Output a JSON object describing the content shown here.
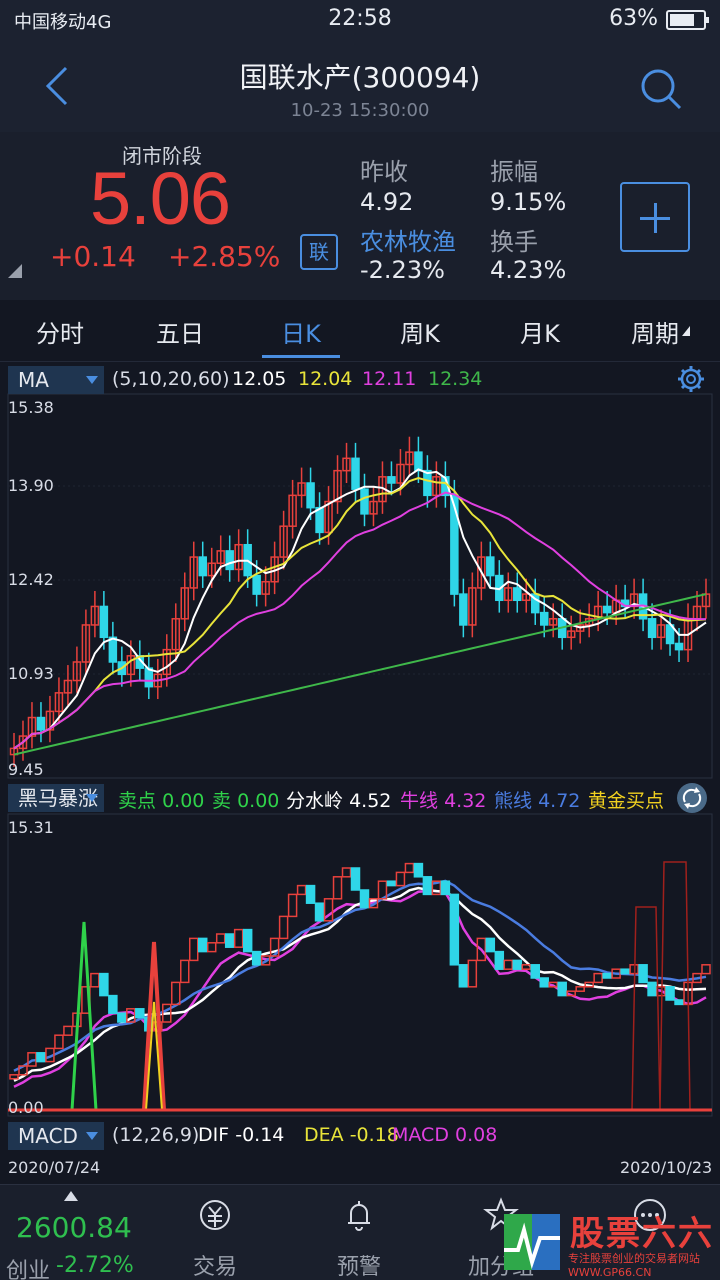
{
  "status": {
    "carrier": "中国移动4G",
    "time": "22:58",
    "battery": "63%"
  },
  "nav": {
    "title": "国联水产(300094)",
    "subtitle": "10-23 15:30:00"
  },
  "quote": {
    "phase": "闭市阶段",
    "price": "5.06",
    "change": "+0.14",
    "change_pct": "+2.85%",
    "badge": "联",
    "prev_close_label": "昨收",
    "prev_close": "4.92",
    "amplitude_label": "振幅",
    "amplitude": "9.15%",
    "sector": "农林牧渔",
    "sector_change": "-2.23%",
    "turnover_label": "换手",
    "turnover": "4.23%"
  },
  "tabs": [
    "分时",
    "五日",
    "日K",
    "周K",
    "月K",
    "周期"
  ],
  "active_tab": "日K",
  "ma": {
    "selector": "MA",
    "params": "(5,10,20,60)",
    "values": [
      {
        "v": "12.05",
        "color": "#ffffff"
      },
      {
        "v": "12.04",
        "color": "#e8e43a"
      },
      {
        "v": "12.11",
        "color": "#e040e0"
      },
      {
        "v": "12.34",
        "color": "#3fb84a"
      }
    ],
    "ylabels": [
      "15.38",
      "13.90",
      "12.42",
      "10.93",
      "9.45"
    ]
  },
  "indicator": {
    "selector": "黑马暴涨",
    "items": [
      {
        "label": "卖点",
        "value": "0.00",
        "color": "#2fd24a"
      },
      {
        "label": "卖",
        "value": "0.00",
        "color": "#2fd24a"
      },
      {
        "label": "分水岭",
        "value": "4.52",
        "color": "#ffffff"
      },
      {
        "label": "牛线",
        "value": "4.32",
        "color": "#e040e0"
      },
      {
        "label": "熊线",
        "value": "4.72",
        "color": "#4a7ce0"
      },
      {
        "label": "黄金买点",
        "value": "",
        "color": "#f0d020"
      }
    ],
    "ylabels": [
      "15.31",
      "0.00"
    ]
  },
  "macd": {
    "selector": "MACD",
    "params": "(12,26,9)",
    "items": [
      {
        "label": "DIF",
        "value": "-0.14",
        "color": "#ffffff"
      },
      {
        "label": "DEA",
        "value": "-0.18",
        "color": "#e8e43a"
      },
      {
        "label": "MACD",
        "value": "0.08",
        "color": "#e040e0"
      }
    ]
  },
  "dates": {
    "start": "2020/07/24",
    "end": "2020/10/23"
  },
  "bottom": {
    "index_value": "2600.84",
    "index_name": "创业",
    "index_change": "-2.72%",
    "nav": [
      "交易",
      "预警",
      "加分组"
    ]
  },
  "watermark": {
    "title": "股票六六",
    "subtitle": "专注股票创业的交易者网站 WWW.GP66.CN"
  }
}
